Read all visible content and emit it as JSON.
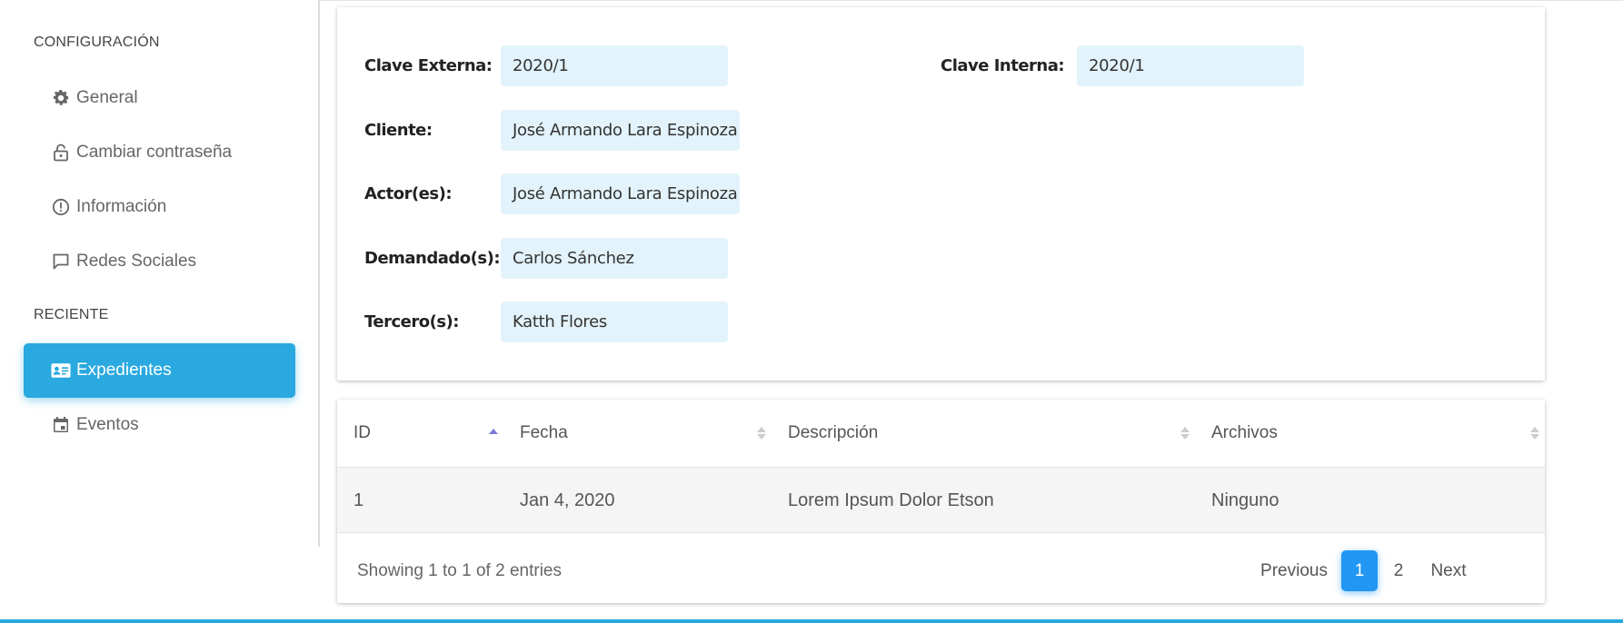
{
  "sidebar": {
    "config_title": "CONFIGURACIÓN",
    "recent_title": "RECIENTE",
    "config_items": [
      {
        "label": "General",
        "icon": "gear-icon"
      },
      {
        "label": "Cambiar contraseña",
        "icon": "lock-icon"
      },
      {
        "label": "Información",
        "icon": "info-circle-icon"
      },
      {
        "label": "Redes Sociales",
        "icon": "chat-icon"
      }
    ],
    "recent_items": [
      {
        "label": "Expedientes",
        "icon": "id-card-icon",
        "active": true
      },
      {
        "label": "Eventos",
        "icon": "calendar-icon",
        "active": false
      }
    ]
  },
  "form": {
    "clave_externa_label": "Clave Externa:",
    "clave_externa_value": "2020/1",
    "clave_interna_label": "Clave Interna:",
    "clave_interna_value": "2020/1",
    "cliente_label": "Cliente:",
    "cliente_value": "José Armando Lara Espinoza",
    "actor_label": "Actor(es):",
    "actor_value": "José Armando Lara Espinoza",
    "demandado_label": "Demandado(s):",
    "demandado_value": "Carlos Sánchez",
    "tercero_label": "Tercero(s):",
    "tercero_value": "Katth Flores"
  },
  "table": {
    "columns": [
      "ID",
      "Fecha",
      "Descripción",
      "Archivos"
    ],
    "rows": [
      [
        "1",
        "Jan 4, 2020",
        "Lorem Ipsum Dolor Etson",
        "Ninguno"
      ]
    ],
    "info": "Showing 1 to 1 of 2 entries",
    "pagination": {
      "previous": "Previous",
      "pages": [
        "1",
        "2"
      ],
      "current": "1",
      "next": "Next"
    }
  },
  "colors": {
    "accent": "#29a9e0",
    "pager_active": "#2196f3",
    "field_bg": "#e3f3fb"
  }
}
